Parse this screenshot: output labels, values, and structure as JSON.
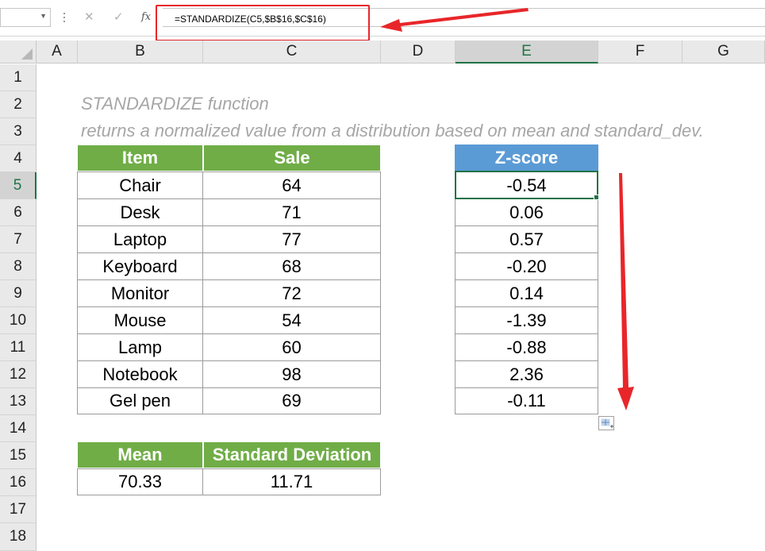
{
  "formula_bar": {
    "name_box": "",
    "cancel_icon": "✕",
    "enter_icon": "✓",
    "fx_label": "fx",
    "formula": "=STANDARDIZE(C5,$B$16,$C$16)"
  },
  "columns": [
    "A",
    "B",
    "C",
    "D",
    "E",
    "F",
    "G"
  ],
  "rows": [
    "1",
    "2",
    "3",
    "4",
    "5",
    "6",
    "7",
    "8",
    "9",
    "10",
    "11",
    "12",
    "13",
    "14",
    "15",
    "16",
    "17",
    "18"
  ],
  "notes": {
    "line1": "STANDARDIZE  function",
    "line2": "returns a normalized value from a distribution based on mean and standard_dev."
  },
  "sales_table": {
    "headers": [
      "Item",
      "Sale"
    ],
    "rows": [
      [
        "Chair",
        "64"
      ],
      [
        "Desk",
        "71"
      ],
      [
        "Laptop",
        "77"
      ],
      [
        "Keyboard",
        "68"
      ],
      [
        "Monitor",
        "72"
      ],
      [
        "Mouse",
        "54"
      ],
      [
        "Lamp",
        "60"
      ],
      [
        "Notebook",
        "98"
      ],
      [
        "Gel pen",
        "69"
      ]
    ]
  },
  "zscore_table": {
    "header": "Z-score",
    "values": [
      "-0.54",
      "0.06",
      "0.57",
      "-0.20",
      "0.14",
      "-1.39",
      "-0.88",
      "2.36",
      "-0.11"
    ]
  },
  "stats_table": {
    "headers": [
      "Mean",
      "Standard Deviation"
    ],
    "values": [
      "70.33",
      "11.71"
    ]
  },
  "colors": {
    "green_header": "#70ad47",
    "blue_header": "#5b9bd5",
    "selection": "#217346",
    "annotation_red": "#e8262a"
  }
}
